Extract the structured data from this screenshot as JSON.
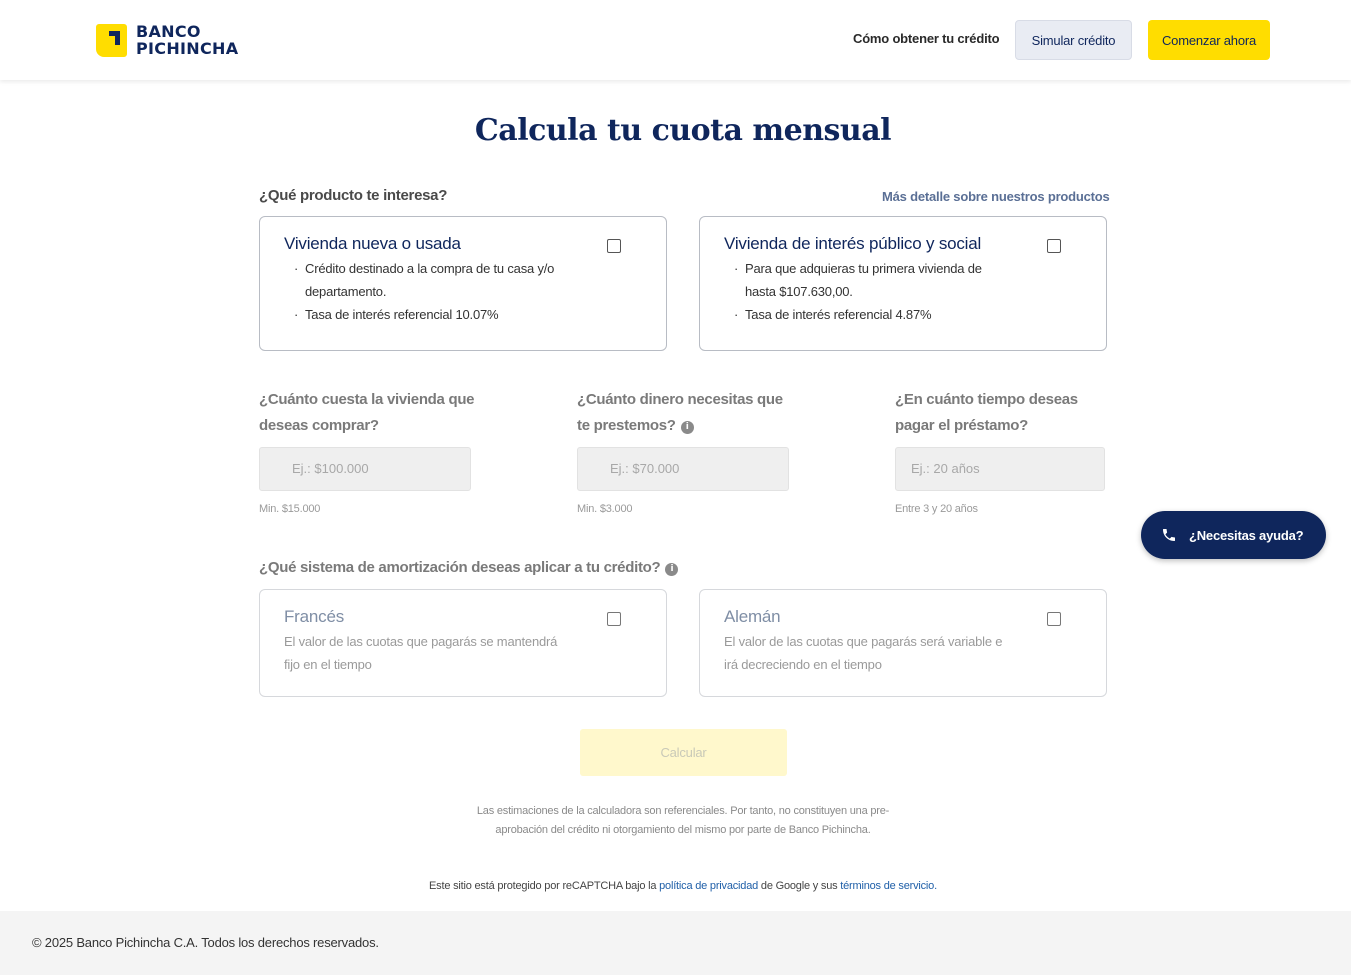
{
  "header": {
    "logo_line1": "BANCO",
    "logo_line2": "PICHINCHA",
    "nav_link": "Cómo obtener tu crédito",
    "simulate_label": "Simular crédito",
    "start_label": "Comenzar ahora"
  },
  "page_title": "Calcula tu cuota mensual",
  "products": {
    "question": "¿Qué producto te interesa?",
    "more_link": "Más detalle sobre nuestros productos",
    "options": [
      {
        "title": "Vivienda nueva o usada",
        "bullets": [
          "Crédito destinado a la compra de tu casa y/o",
          "departamento.",
          "Tasa de interés referencial 10.07%"
        ],
        "checked": false
      },
      {
        "title": "Vivienda de interés público y social",
        "bullets": [
          "Para que adquieras tu primera vivienda de",
          "hasta $107.630,00.",
          "Tasa de interés referencial 4.87%"
        ],
        "checked": false
      }
    ]
  },
  "fields": [
    {
      "label_line1": "¿Cuánto cuesta la vivienda que",
      "label_line2": "deseas comprar?",
      "placeholder": "Ej.: $100.000",
      "hint": "Min. $15.000"
    },
    {
      "label_line1": "¿Cuánto dinero necesitas que",
      "label_line2": "te prestemos?",
      "placeholder": "Ej.: $70.000",
      "hint": "Min. $3.000"
    },
    {
      "label_line1": "¿En cuánto tiempo deseas",
      "label_line2": "pagar el préstamo?",
      "placeholder": "Ej.: 20 años",
      "hint": "Entre 3 y 20 años"
    }
  ],
  "amortization": {
    "question": "¿Qué sistema de amortización deseas aplicar a tu crédito?",
    "options": [
      {
        "title": "Francés",
        "desc_line1": "El valor de las cuotas que pagarás se mantendrá",
        "desc_line2": "fijo en el tiempo",
        "checked": false
      },
      {
        "title": "Alemán",
        "desc_line1": "El valor de las cuotas que pagarás será variable e",
        "desc_line2": "irá decreciendo en el tiempo",
        "checked": false
      }
    ]
  },
  "calc_label": "Calcular",
  "help_label": "¿Necesitas ayuda?",
  "info_icon_glyph": "i",
  "disclaimer_line1": "Las estimaciones de la calculadora son referenciales. Por tanto, no constituyen una pre-",
  "disclaimer_line2": "aprobación del crédito ni otorgamiento del mismo por parte de Banco Pichincha.",
  "recaptcha": {
    "prefix": "Este sitio está protegido por reCAPTCHA bajo la ",
    "privacy": "política de privacidad",
    "middle": " de Google y sus ",
    "terms": "términos de servicio."
  },
  "footer": {
    "copyright": "© 2025 Banco Pichincha C.A. Todos los derechos reservados."
  },
  "colors": {
    "brand_navy": "#0f265c",
    "brand_yellow": "#ffdd00",
    "link_blue": "#1f5fa8"
  },
  "icons": {
    "help": "phone-icon",
    "info": "info-icon",
    "logo": "banco-pichincha-logo"
  }
}
